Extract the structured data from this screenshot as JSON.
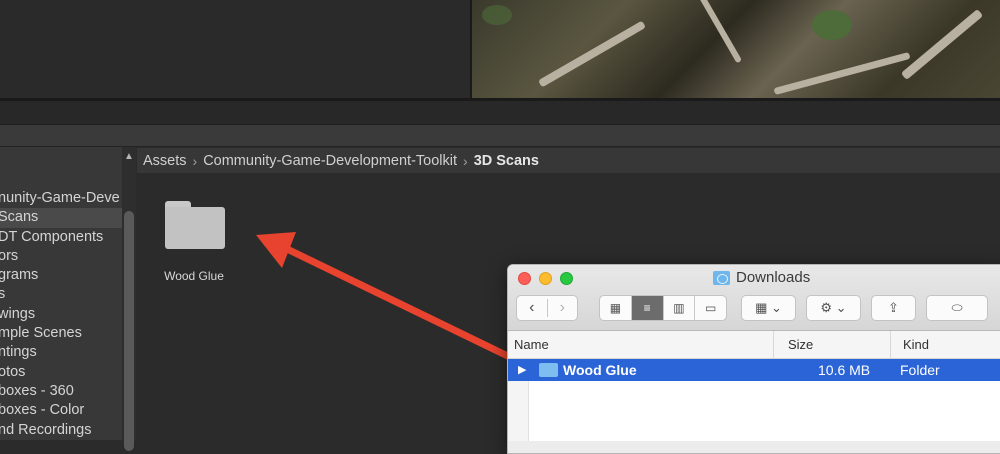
{
  "sidebar": {
    "items": [
      {
        "label": "nunity-Game-Deve",
        "selected": false
      },
      {
        "label": "Scans",
        "selected": true
      },
      {
        "label": "DT Components",
        "selected": false
      },
      {
        "label": "ors",
        "selected": false
      },
      {
        "label": "grams",
        "selected": false
      },
      {
        "label": "s",
        "selected": false
      },
      {
        "label": "wings",
        "selected": false
      },
      {
        "label": "mple Scenes",
        "selected": false
      },
      {
        "label": "ntings",
        "selected": false
      },
      {
        "label": "otos",
        "selected": false
      },
      {
        "label": "boxes - 360",
        "selected": false
      },
      {
        "label": "boxes - Color",
        "selected": false
      },
      {
        "label": "nd Recordings",
        "selected": false
      }
    ]
  },
  "breadcrumb": {
    "items": [
      "Assets",
      "Community-Game-Development-Toolkit",
      "3D Scans"
    ],
    "separator": "›"
  },
  "project_grid": {
    "folder_label": "Wood Glue"
  },
  "finder": {
    "title": "Downloads",
    "columns": {
      "name": "Name",
      "size": "Size",
      "kind": "Kind"
    },
    "rows": [
      {
        "name": "Wood Glue",
        "size": "10.6 MB",
        "kind": "Folder",
        "selected": true
      }
    ],
    "icons": {
      "back": "‹",
      "forward": "›",
      "icon_view": "▦",
      "list_view": "≡",
      "column_view": "▥",
      "gallery_view": "▭",
      "group": "▦ ⌄",
      "action": "⚙ ⌄",
      "share": "⇪",
      "tag": "⬭"
    }
  },
  "colors": {
    "selection_blue": "#2a64d6",
    "arrow_red": "#e8432e"
  }
}
